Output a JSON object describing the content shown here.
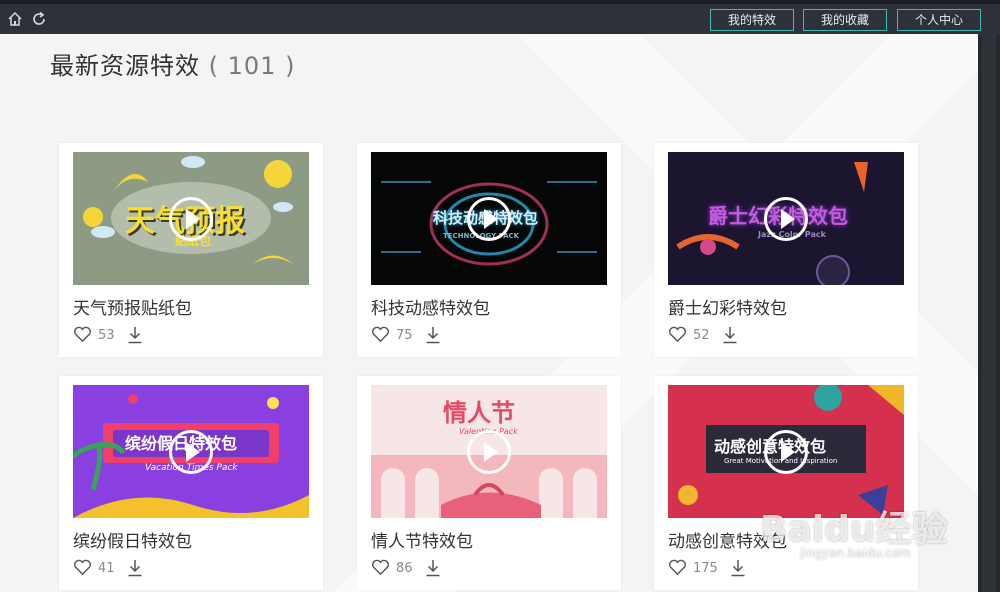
{
  "toolbar": {
    "buttons": [
      {
        "label": "我的特效"
      },
      {
        "label": "我的收藏"
      },
      {
        "label": "个人中心"
      }
    ]
  },
  "header": {
    "title": "最新资源特效",
    "count_text": "( 101 )"
  },
  "cards": [
    {
      "title": "天气预报贴纸包",
      "likes": "53",
      "thumb_text": "天气预报",
      "thumb_sub": "贴纸包"
    },
    {
      "title": "科技动感特效包",
      "likes": "75",
      "thumb_text": "科技动感特效包",
      "thumb_sub": "TECHNOLOGY PACK"
    },
    {
      "title": "爵士幻彩特效包",
      "likes": "52",
      "thumb_text": "爵士幻彩特效包",
      "thumb_sub": "Jazz Color Pack"
    },
    {
      "title": "缤纷假日特效包",
      "likes": "41",
      "thumb_text": "缤纷假日特效包",
      "thumb_sub": "Vacation Times Pack"
    },
    {
      "title": "情人节特效包",
      "likes": "86",
      "thumb_text": "情人节",
      "thumb_sub": "Valentine Pack"
    },
    {
      "title": "动感创意特效包",
      "likes": "175",
      "thumb_text": "动感创意特效包",
      "thumb_sub": "Great Motivation and Inspiration"
    }
  ],
  "watermark": {
    "text": "Baidu经验",
    "sub": "jingyan.baidu.com"
  },
  "colors": {
    "topbar": "#2c313a",
    "accent_border": "#3fb6b0",
    "background": "#f4f4f5"
  },
  "icons": {
    "home": "home-icon",
    "refresh": "refresh-icon",
    "like": "heart-icon",
    "download": "download-icon",
    "play": "play-icon"
  }
}
